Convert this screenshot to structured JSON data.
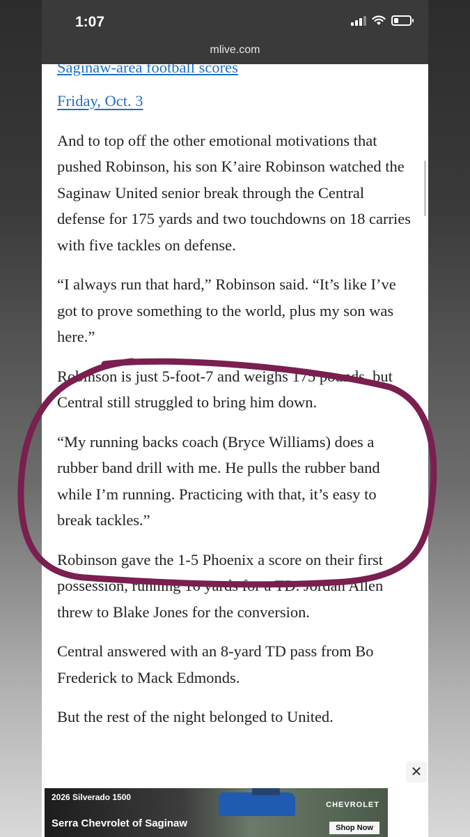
{
  "status_bar": {
    "time": "1:07"
  },
  "browser": {
    "url": "mlive.com"
  },
  "article": {
    "related_link_cut": "Saginaw-area football scores",
    "related_link_date": "Friday, Oct. 3",
    "paragraphs": [
      "And to top off the other emotional motivations that pushed Robinson, his son K’aire Robinson watched the Saginaw United senior break through the Central defense for 175 yards and two touchdowns on 18 carries with five tackles on defense.",
      "“I always run that hard,” Robinson said. “It’s like I’ve got to prove something to the world, plus my son was here.”",
      "Robinson is just 5-foot-7 and weighs 175 pounds, but Central still struggled to bring him down.",
      "“My running backs coach (Bryce Williams) does a rubber band drill with me. He pulls the rubber band while I’m running. Practicing with that, it’s easy to break tackles.”",
      "Robinson gave the 1-5 Phoenix a score on their first possession, running 16 yards for a TD. Jordan Allen threw to Blake Jones for the conversion.",
      "Central answered with an 8-yard TD pass from Bo Frederick to Mack Edmonds.",
      "But the rest of the night belonged to United."
    ]
  },
  "ad": {
    "close_label": "✕",
    "headline": "2026 Silverado 1500",
    "dealer": "Serra Chevrolet of Saginaw",
    "brand": "CHEVROLET",
    "cta": "Shop Now"
  },
  "colors": {
    "link": "#1f6fc5",
    "annotation_circle": "#7a1f4f",
    "status_bar": "#3a3a3a"
  }
}
